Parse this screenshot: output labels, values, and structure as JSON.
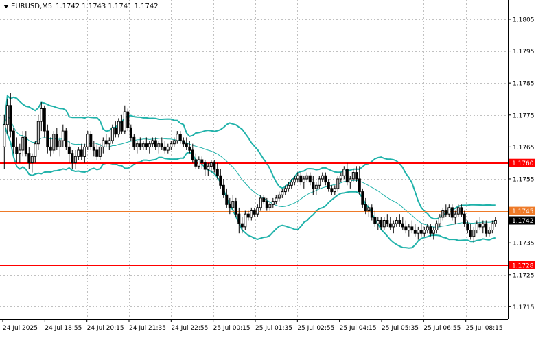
{
  "window": {
    "symbol_label": "EURUSD,M5",
    "ohlc_label": "1.1742 1.1743 1.1741 1.1742"
  },
  "colors": {
    "candle": "#000000",
    "band": "#20b2aa",
    "middle_band": "#20b2aa",
    "support_resistance": "#ff0000",
    "current_price_line": "#ee7a28",
    "bid_line": "#c0c0c0",
    "grid": "#c0c0c0",
    "background": "#ffffff"
  },
  "chart_data": {
    "type": "candlestick",
    "symbol": "EURUSD",
    "timeframe": "M5",
    "ylim": [
      1.1711,
      1.1811
    ],
    "y_ticks": [
      "1.1805",
      "1.1795",
      "1.1785",
      "1.1775",
      "1.1765",
      "1.1755",
      "1.1745",
      "1.1735",
      "1.1725",
      "1.1715"
    ],
    "x_ticks": [
      "24 Jul 2025",
      "24 Jul 18:55",
      "24 Jul 20:15",
      "24 Jul 21:35",
      "24 Jul 22:55",
      "25 Jul 00:15",
      "25 Jul 01:35",
      "25 Jul 02:55",
      "25 Jul 04:15",
      "25 Jul 05:35",
      "25 Jul 06:55",
      "25 Jul 08:15"
    ],
    "horizontal_levels": [
      {
        "price": 1.176,
        "label": "1.1760",
        "kind": "resistance"
      },
      {
        "price": 1.1728,
        "label": "1.1728",
        "kind": "support"
      }
    ],
    "price_markers": [
      {
        "price": 1.1745,
        "label": "1.1745",
        "kind": "indicator"
      },
      {
        "price": 1.1742,
        "label": "1.1742",
        "kind": "bid"
      }
    ],
    "session_separator": {
      "at_candle": 86
    },
    "candles": [
      [
        1.1765,
        1.1775,
        1.1758,
        1.1772
      ],
      [
        1.1772,
        1.178,
        1.1769,
        1.1778
      ],
      [
        1.1778,
        1.1782,
        1.1768,
        1.177
      ],
      [
        1.177,
        1.1771,
        1.1763,
        1.1765
      ],
      [
        1.1765,
        1.1768,
        1.176,
        1.1763
      ],
      [
        1.1763,
        1.1766,
        1.176,
        1.1764
      ],
      [
        1.1764,
        1.177,
        1.1762,
        1.1768
      ],
      [
        1.1768,
        1.177,
        1.1762,
        1.1763
      ],
      [
        1.1763,
        1.1765,
        1.1758,
        1.176
      ],
      [
        1.176,
        1.1763,
        1.1757,
        1.1762
      ],
      [
        1.1762,
        1.1767,
        1.176,
        1.1766
      ],
      [
        1.1766,
        1.1775,
        1.1764,
        1.1773
      ],
      [
        1.1773,
        1.1779,
        1.177,
        1.1777
      ],
      [
        1.1777,
        1.1778,
        1.1768,
        1.177
      ],
      [
        1.177,
        1.1772,
        1.1763,
        1.1765
      ],
      [
        1.1765,
        1.1768,
        1.1762,
        1.1764
      ],
      [
        1.1764,
        1.177,
        1.1763,
        1.1769
      ],
      [
        1.1769,
        1.1771,
        1.1764,
        1.1765
      ],
      [
        1.1765,
        1.1768,
        1.1762,
        1.1767
      ],
      [
        1.1767,
        1.1772,
        1.1765,
        1.177
      ],
      [
        1.177,
        1.1771,
        1.1764,
        1.1765
      ],
      [
        1.1765,
        1.1767,
        1.176,
        1.1763
      ],
      [
        1.1763,
        1.1764,
        1.1758,
        1.176
      ],
      [
        1.176,
        1.1764,
        1.1758,
        1.1762
      ],
      [
        1.1762,
        1.1765,
        1.1761,
        1.1764
      ],
      [
        1.1764,
        1.1766,
        1.1761,
        1.1762
      ],
      [
        1.1762,
        1.1766,
        1.176,
        1.1765
      ],
      [
        1.1765,
        1.177,
        1.1764,
        1.1769
      ],
      [
        1.1769,
        1.177,
        1.1764,
        1.1765
      ],
      [
        1.1765,
        1.1767,
        1.1762,
        1.1764
      ],
      [
        1.1764,
        1.1766,
        1.1761,
        1.1762
      ],
      [
        1.1762,
        1.1766,
        1.1761,
        1.1765
      ],
      [
        1.1765,
        1.1768,
        1.1763,
        1.1767
      ],
      [
        1.1767,
        1.1769,
        1.1765,
        1.1766
      ],
      [
        1.1766,
        1.1768,
        1.1764,
        1.1767
      ],
      [
        1.1767,
        1.1772,
        1.1766,
        1.1771
      ],
      [
        1.1771,
        1.1773,
        1.1768,
        1.1769
      ],
      [
        1.1769,
        1.1774,
        1.1768,
        1.1773
      ],
      [
        1.1773,
        1.1775,
        1.1769,
        1.177
      ],
      [
        1.177,
        1.1778,
        1.1769,
        1.1776
      ],
      [
        1.1776,
        1.1777,
        1.177,
        1.1771
      ],
      [
        1.1771,
        1.1772,
        1.1767,
        1.1768
      ],
      [
        1.1768,
        1.1769,
        1.1764,
        1.1765
      ],
      [
        1.1765,
        1.1767,
        1.1763,
        1.1766
      ],
      [
        1.1766,
        1.1768,
        1.1764,
        1.1765
      ],
      [
        1.1765,
        1.1767,
        1.1764,
        1.1766
      ],
      [
        1.1766,
        1.1768,
        1.1764,
        1.1765
      ],
      [
        1.1765,
        1.1767,
        1.1763,
        1.1766
      ],
      [
        1.1766,
        1.1768,
        1.1765,
        1.1767
      ],
      [
        1.1767,
        1.1768,
        1.1764,
        1.1765
      ],
      [
        1.1765,
        1.1767,
        1.1763,
        1.1766
      ],
      [
        1.1766,
        1.1768,
        1.1764,
        1.1765
      ],
      [
        1.1765,
        1.1767,
        1.1763,
        1.1764
      ],
      [
        1.1764,
        1.1766,
        1.1763,
        1.1765
      ],
      [
        1.1765,
        1.1767,
        1.1764,
        1.1766
      ],
      [
        1.1766,
        1.1768,
        1.1765,
        1.1767
      ],
      [
        1.1767,
        1.177,
        1.1766,
        1.1769
      ],
      [
        1.1769,
        1.177,
        1.1766,
        1.1767
      ],
      [
        1.1767,
        1.1768,
        1.1765,
        1.1766
      ],
      [
        1.1766,
        1.1768,
        1.1764,
        1.1765
      ],
      [
        1.1765,
        1.1767,
        1.1763,
        1.1764
      ],
      [
        1.1764,
        1.1766,
        1.176,
        1.1761
      ],
      [
        1.1761,
        1.1763,
        1.1758,
        1.1759
      ],
      [
        1.1759,
        1.1762,
        1.1758,
        1.1761
      ],
      [
        1.1761,
        1.1762,
        1.1758,
        1.176
      ],
      [
        1.176,
        1.1761,
        1.1756,
        1.1758
      ],
      [
        1.1758,
        1.176,
        1.1756,
        1.1759
      ],
      [
        1.1759,
        1.1761,
        1.1757,
        1.176
      ],
      [
        1.176,
        1.1761,
        1.1757,
        1.1758
      ],
      [
        1.1758,
        1.176,
        1.1755,
        1.1756
      ],
      [
        1.1756,
        1.1758,
        1.1752,
        1.1753
      ],
      [
        1.1753,
        1.1755,
        1.1749,
        1.175
      ],
      [
        1.175,
        1.1752,
        1.1746,
        1.1747
      ],
      [
        1.1747,
        1.1749,
        1.1744,
        1.1746
      ],
      [
        1.1746,
        1.175,
        1.1745,
        1.1748
      ],
      [
        1.1748,
        1.1749,
        1.1743,
        1.1744
      ],
      [
        1.1744,
        1.1746,
        1.1738,
        1.1741
      ],
      [
        1.1741,
        1.1743,
        1.1738,
        1.174
      ],
      [
        1.174,
        1.1745,
        1.1739,
        1.1744
      ],
      [
        1.1744,
        1.1745,
        1.1742,
        1.1743
      ],
      [
        1.1743,
        1.1746,
        1.1742,
        1.1745
      ],
      [
        1.1745,
        1.1746,
        1.1743,
        1.1744
      ],
      [
        1.1744,
        1.1747,
        1.1743,
        1.1746
      ],
      [
        1.1746,
        1.175,
        1.1745,
        1.1749
      ],
      [
        1.1749,
        1.175,
        1.1747,
        1.1748
      ],
      [
        1.1748,
        1.1749,
        1.1745,
        1.1746
      ],
      [
        1.1746,
        1.1748,
        1.1745,
        1.1747
      ],
      [
        1.1747,
        1.1749,
        1.1746,
        1.1748
      ],
      [
        1.1748,
        1.175,
        1.1747,
        1.1749
      ],
      [
        1.1749,
        1.1751,
        1.1748,
        1.175
      ],
      [
        1.175,
        1.1752,
        1.1749,
        1.1751
      ],
      [
        1.1751,
        1.1753,
        1.175,
        1.1752
      ],
      [
        1.1752,
        1.1754,
        1.1751,
        1.1753
      ],
      [
        1.1753,
        1.1755,
        1.1752,
        1.1754
      ],
      [
        1.1754,
        1.1756,
        1.1753,
        1.1755
      ],
      [
        1.1755,
        1.1757,
        1.1754,
        1.1756
      ],
      [
        1.1756,
        1.1757,
        1.1753,
        1.1754
      ],
      [
        1.1754,
        1.1756,
        1.1752,
        1.1755
      ],
      [
        1.1755,
        1.1757,
        1.1754,
        1.1756
      ],
      [
        1.1756,
        1.1757,
        1.1753,
        1.1754
      ],
      [
        1.1754,
        1.1756,
        1.175,
        1.1752
      ],
      [
        1.1752,
        1.1754,
        1.175,
        1.1753
      ],
      [
        1.1753,
        1.1756,
        1.1752,
        1.1755
      ],
      [
        1.1755,
        1.1757,
        1.1754,
        1.1756
      ],
      [
        1.1756,
        1.1757,
        1.1753,
        1.1754
      ],
      [
        1.1754,
        1.1755,
        1.1751,
        1.1752
      ],
      [
        1.1752,
        1.1753,
        1.175,
        1.1751
      ],
      [
        1.1751,
        1.1753,
        1.175,
        1.1752
      ],
      [
        1.1752,
        1.1756,
        1.1751,
        1.1755
      ],
      [
        1.1755,
        1.1757,
        1.1754,
        1.1756
      ],
      [
        1.1756,
        1.1759,
        1.1755,
        1.1758
      ],
      [
        1.1758,
        1.176,
        1.1753,
        1.1754
      ],
      [
        1.1754,
        1.1756,
        1.1752,
        1.1755
      ],
      [
        1.1755,
        1.1758,
        1.1754,
        1.1757
      ],
      [
        1.1757,
        1.1759,
        1.1754,
        1.1755
      ],
      [
        1.1755,
        1.1759,
        1.175,
        1.1751
      ],
      [
        1.1751,
        1.1752,
        1.1746,
        1.1747
      ],
      [
        1.1747,
        1.1749,
        1.1744,
        1.1745
      ],
      [
        1.1745,
        1.1747,
        1.1743,
        1.1746
      ],
      [
        1.1746,
        1.1747,
        1.1742,
        1.1743
      ],
      [
        1.1743,
        1.1745,
        1.174,
        1.1741
      ],
      [
        1.1741,
        1.1743,
        1.1739,
        1.1742
      ],
      [
        1.1742,
        1.1743,
        1.1739,
        1.174
      ],
      [
        1.174,
        1.1743,
        1.1739,
        1.1742
      ],
      [
        1.1742,
        1.1744,
        1.174,
        1.1741
      ],
      [
        1.1741,
        1.1743,
        1.1739,
        1.174
      ],
      [
        1.174,
        1.1742,
        1.1738,
        1.1741
      ],
      [
        1.1741,
        1.1743,
        1.174,
        1.1742
      ],
      [
        1.1742,
        1.1744,
        1.174,
        1.1741
      ],
      [
        1.1741,
        1.1743,
        1.1739,
        1.174
      ],
      [
        1.174,
        1.1742,
        1.1738,
        1.1739
      ],
      [
        1.1739,
        1.1741,
        1.1737,
        1.174
      ],
      [
        1.174,
        1.1742,
        1.1738,
        1.1739
      ],
      [
        1.1739,
        1.1741,
        1.1737,
        1.1738
      ],
      [
        1.1738,
        1.174,
        1.1736,
        1.1739
      ],
      [
        1.1739,
        1.1741,
        1.1737,
        1.1738
      ],
      [
        1.1738,
        1.174,
        1.1737,
        1.1739
      ],
      [
        1.1739,
        1.1741,
        1.1738,
        1.174
      ],
      [
        1.174,
        1.1741,
        1.1737,
        1.1738
      ],
      [
        1.1738,
        1.174,
        1.1736,
        1.1739
      ],
      [
        1.1739,
        1.1742,
        1.1738,
        1.1741
      ],
      [
        1.1741,
        1.1744,
        1.174,
        1.1743
      ],
      [
        1.1743,
        1.1746,
        1.1742,
        1.1745
      ],
      [
        1.1745,
        1.1747,
        1.1743,
        1.1744
      ],
      [
        1.1744,
        1.1747,
        1.1743,
        1.1746
      ],
      [
        1.1746,
        1.1747,
        1.1742,
        1.1743
      ],
      [
        1.1743,
        1.1745,
        1.1741,
        1.1744
      ],
      [
        1.1744,
        1.1747,
        1.1743,
        1.1746
      ],
      [
        1.1746,
        1.1747,
        1.1743,
        1.1744
      ],
      [
        1.1744,
        1.1745,
        1.174,
        1.1741
      ],
      [
        1.1741,
        1.1742,
        1.1738,
        1.1739
      ],
      [
        1.1739,
        1.1741,
        1.1736,
        1.1737
      ],
      [
        1.1737,
        1.174,
        1.1735,
        1.1739
      ],
      [
        1.1739,
        1.1742,
        1.1738,
        1.1741
      ],
      [
        1.1741,
        1.1743,
        1.1739,
        1.174
      ],
      [
        1.174,
        1.1742,
        1.1738,
        1.1741
      ],
      [
        1.1741,
        1.1742,
        1.1737,
        1.1738
      ],
      [
        1.1738,
        1.174,
        1.1737,
        1.1739
      ],
      [
        1.1739,
        1.1742,
        1.1738,
        1.1741
      ],
      [
        1.1741,
        1.1743,
        1.174,
        1.1742
      ]
    ]
  }
}
